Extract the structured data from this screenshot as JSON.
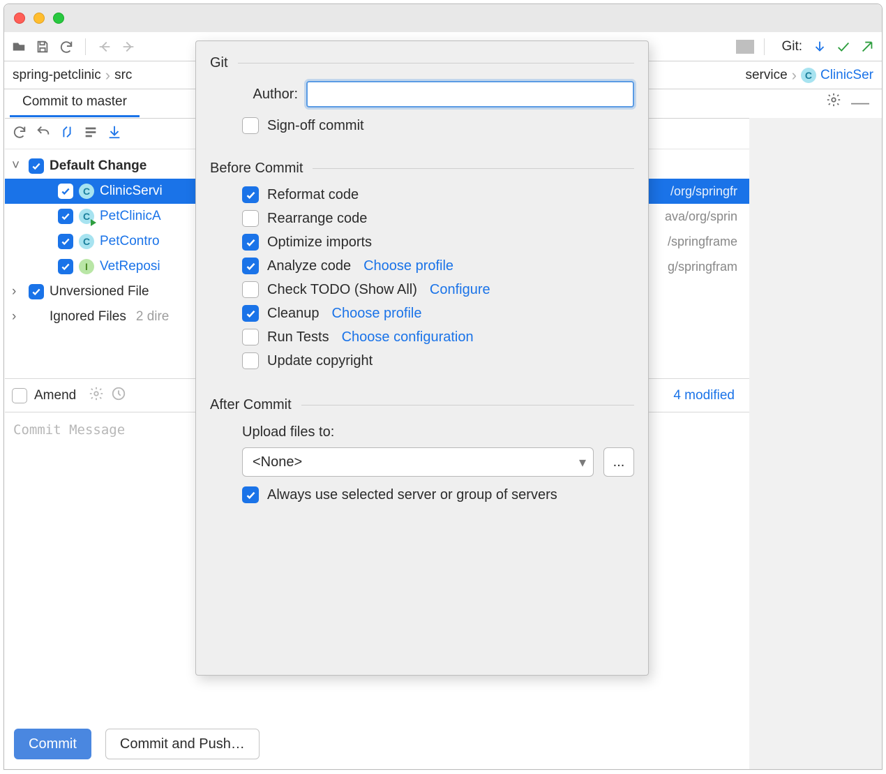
{
  "toolbar": {
    "git_label": "Git:"
  },
  "breadcrumbs": {
    "items": [
      "spring-petclinic",
      "src"
    ],
    "tail": [
      "service"
    ],
    "file": "ClinicSer"
  },
  "tab": {
    "label": "Commit to master"
  },
  "changes": {
    "default_label": "Default Change",
    "files": [
      {
        "name": "ClinicServi",
        "path": "/org/springfr",
        "icon": "class-icon-c",
        "selected": true
      },
      {
        "name": "PetClinicA",
        "path": "ava/org/sprin",
        "icon": "class-icon-c-run",
        "selected": false
      },
      {
        "name": "PetContro",
        "path": "/springframe",
        "icon": "class-icon-c",
        "selected": false
      },
      {
        "name": "VetReposi",
        "path": "g/springfram",
        "icon": "interface-icon-i",
        "selected": false
      }
    ],
    "unversioned_label": "Unversioned File",
    "ignored_label": "Ignored Files",
    "ignored_suffix": "2 dire"
  },
  "amend": {
    "label": "Amend",
    "trail": "4 modified"
  },
  "commit_message_placeholder": "Commit Message",
  "buttons": {
    "commit": "Commit",
    "commit_push": "Commit and Push…"
  },
  "popover": {
    "git": {
      "title": "Git",
      "author_label": "Author:",
      "signoff": {
        "label": "Sign-off commit",
        "checked": false
      }
    },
    "before": {
      "title": "Before Commit",
      "items": [
        {
          "label": "Reformat code",
          "checked": true
        },
        {
          "label": "Rearrange code",
          "checked": false
        },
        {
          "label": "Optimize imports",
          "checked": true
        },
        {
          "label": "Analyze code",
          "link": "Choose profile",
          "checked": true
        },
        {
          "label": "Check TODO (Show All)",
          "link": "Configure",
          "checked": false
        },
        {
          "label": "Cleanup",
          "link": "Choose profile",
          "checked": true
        },
        {
          "label": "Run Tests",
          "link": "Choose configuration",
          "checked": false
        },
        {
          "label": "Update copyright",
          "checked": false
        }
      ]
    },
    "after": {
      "title": "After Commit",
      "upload_label": "Upload files to:",
      "upload_value": "<None>",
      "browse": "...",
      "always": {
        "label": "Always use selected server or group of servers",
        "checked": true
      }
    }
  }
}
